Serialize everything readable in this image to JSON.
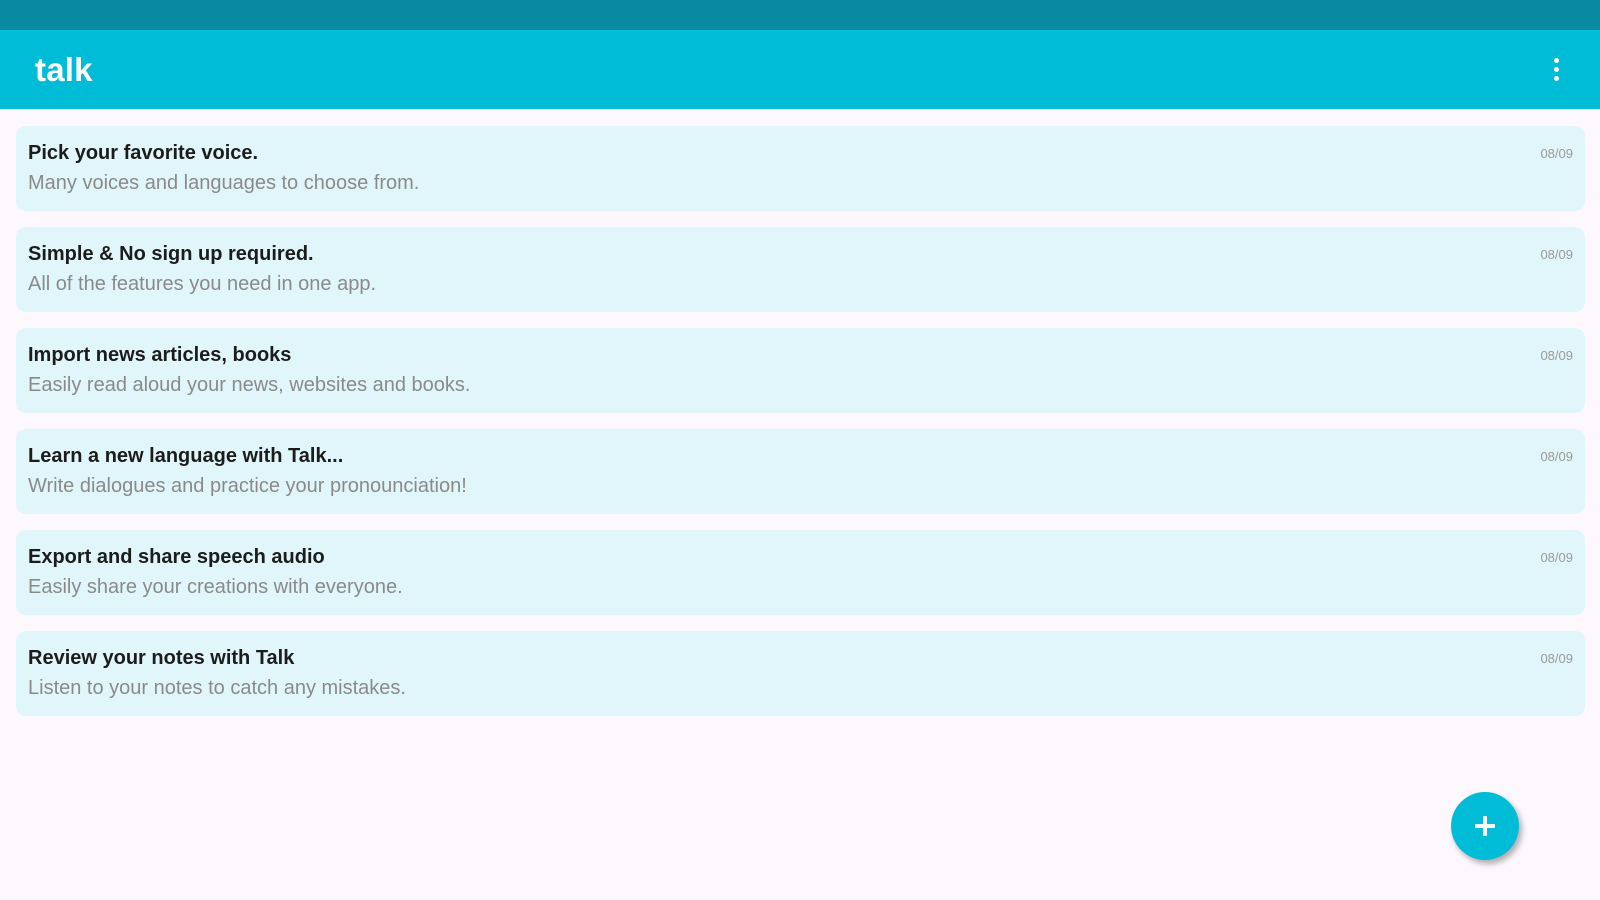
{
  "app": {
    "title": "talk"
  },
  "header": {
    "menu_icon": "more-vert-icon"
  },
  "notes": [
    {
      "title": "Pick your favorite voice.",
      "subtitle": "Many voices and languages to choose from.",
      "date": "08/09"
    },
    {
      "title": "Simple & No sign up required.",
      "subtitle": "All of the features you need in one app.",
      "date": "08/09"
    },
    {
      "title": "Import news articles, books",
      "subtitle": "Easily read aloud your news, websites and books.",
      "date": "08/09"
    },
    {
      "title": "Learn a new language with Talk...",
      "subtitle": "Write dialogues and practice your pronounciation!",
      "date": "08/09"
    },
    {
      "title": "Export and share speech audio",
      "subtitle": "Easily share your creations with everyone.",
      "date": "08/09"
    },
    {
      "title": "Review your notes with Talk",
      "subtitle": "Listen to your notes to catch any mistakes.",
      "date": "08/09"
    }
  ],
  "fab": {
    "icon": "plus-icon"
  },
  "colors": {
    "status_bar": "#0a8aa2",
    "app_bar": "#00bcd6",
    "card_background": "#e1f6fa",
    "page_background": "#fdf8fd"
  }
}
